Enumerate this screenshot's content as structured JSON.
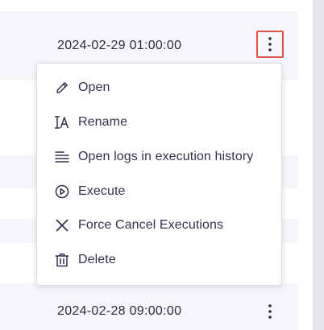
{
  "rows": [
    {
      "date": "2024-02-29 01:00:00",
      "menu_icon": "vertical-dots-icon"
    },
    {
      "date": "2024-02-28 09:00:00",
      "menu_icon": "vertical-dots-icon"
    }
  ],
  "context_menu": {
    "items": [
      {
        "label": "Open",
        "icon": "pencil-icon"
      },
      {
        "label": "Rename",
        "icon": "rename-text-icon"
      },
      {
        "label": "Open logs in execution history",
        "icon": "lines-icon"
      },
      {
        "label": "Execute",
        "icon": "play-circle-icon"
      },
      {
        "label": "Force Cancel Executions",
        "icon": "close-icon"
      },
      {
        "label": "Delete",
        "icon": "trash-icon"
      }
    ]
  },
  "colors": {
    "row_background": "#f6f6fa",
    "highlight_border": "#e0564a",
    "text": "#32324d",
    "scroll_gutter": "#e4e4ea"
  }
}
